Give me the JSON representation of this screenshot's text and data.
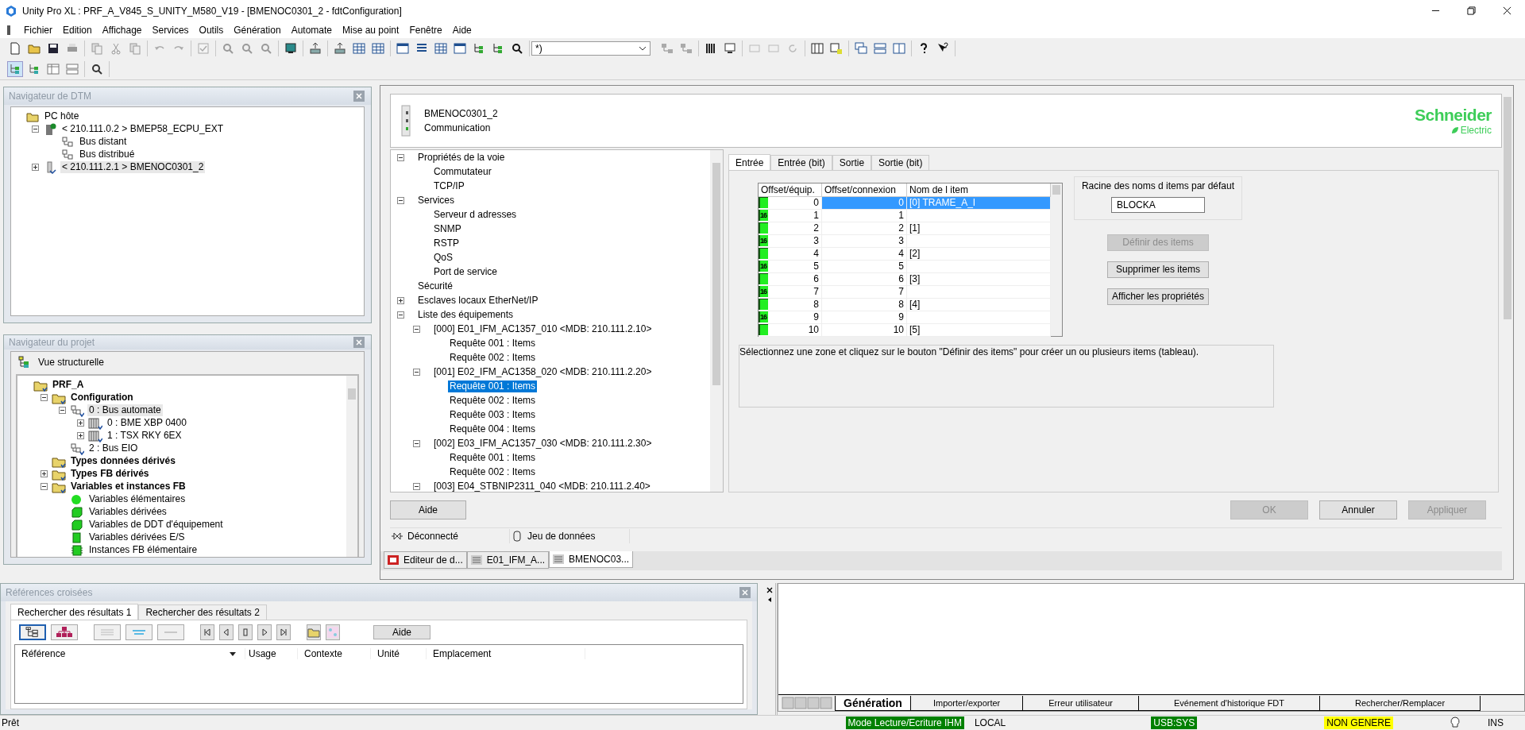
{
  "window": {
    "title": "Unity Pro XL : PRF_A_V845_S_UNITY_M580_V19 - [BMENOC0301_2 - fdtConfiguration]"
  },
  "menu": [
    "Fichier",
    "Edition",
    "Affichage",
    "Services",
    "Outils",
    "Génération",
    "Automate",
    "Mise au point",
    "Fenêtre",
    "Aide"
  ],
  "toolbar": {
    "combo_value": "*)"
  },
  "dtm_navigator": {
    "title": "Navigateur de DTM",
    "tree": [
      {
        "label": "PC hôte",
        "kind": "host",
        "selected": false,
        "children": [
          {
            "label": "< 210.111.0.2 > BMEP58_ECPU_EXT",
            "kind": "cpu",
            "selected": false,
            "expanded": true,
            "children": [
              {
                "label": "Bus distant",
                "kind": "bus",
                "selected": false
              },
              {
                "label": "Bus distribué",
                "kind": "bus",
                "selected": false
              }
            ]
          },
          {
            "label": "< 210.111.2.1 > BMENOC0301_2",
            "kind": "module",
            "selected": true,
            "expanded": false
          }
        ]
      }
    ]
  },
  "project_navigator": {
    "title": "Navigateur du projet",
    "view_label": "Vue structurelle",
    "tree": [
      {
        "label": "PRF_A",
        "kind": "folder",
        "selected": false,
        "children": [
          {
            "label": "Configuration",
            "kind": "folder",
            "selected": false,
            "expanded": true,
            "children": [
              {
                "label": "0 : Bus automate",
                "kind": "bus",
                "selected": true,
                "expanded": true,
                "children": [
                  {
                    "label": "0 : BME XBP 0400",
                    "kind": "rack",
                    "selected": false,
                    "expanded": false
                  },
                  {
                    "label": "1 : TSX RKY 6EX",
                    "kind": "rack",
                    "selected": false,
                    "expanded": false
                  }
                ]
              },
              {
                "label": "2 : Bus EIO",
                "kind": "bus",
                "selected": false
              }
            ]
          },
          {
            "label": "Types données dérivés",
            "kind": "folder",
            "selected": false
          },
          {
            "label": "Types FB dérivés",
            "kind": "folder",
            "selected": false,
            "expanded": false
          },
          {
            "label": "Variables et instances FB",
            "kind": "folder",
            "selected": false,
            "expanded": true,
            "children": [
              {
                "label": "Variables élémentaires",
                "kind": "dot",
                "selected": false
              },
              {
                "label": "Variables dérivées",
                "kind": "cube",
                "selected": false
              },
              {
                "label": "Variables de DDT d'équipement",
                "kind": "cube",
                "selected": false
              },
              {
                "label": "Variables dérivées E/S",
                "kind": "block",
                "selected": false
              },
              {
                "label": "Instances FB élémentaire",
                "kind": "chip",
                "selected": false
              }
            ]
          }
        ]
      }
    ]
  },
  "device": {
    "name": "BMENOC0301_2",
    "category": "Communication",
    "logo": [
      "Schneider",
      "Electric"
    ],
    "tree": [
      {
        "label": "Propriétés de la voie",
        "selected": false,
        "expanded": true,
        "children": [
          {
            "label": "Commutateur",
            "selected": false
          },
          {
            "label": "TCP/IP",
            "selected": false
          }
        ]
      },
      {
        "label": "Services",
        "selected": false,
        "expanded": true,
        "children": [
          {
            "label": "Serveur d adresses",
            "selected": false
          },
          {
            "label": "SNMP",
            "selected": false
          },
          {
            "label": "RSTP",
            "selected": false
          },
          {
            "label": "QoS",
            "selected": false
          },
          {
            "label": "Port de service",
            "selected": false
          }
        ]
      },
      {
        "label": "Sécurité",
        "selected": false
      },
      {
        "label": "Esclaves locaux EtherNet/IP",
        "selected": false,
        "expanded": false
      },
      {
        "label": "Liste des équipements",
        "selected": false,
        "expanded": true,
        "children": [
          {
            "label": "[000] E01_IFM_AC1357_010 <MDB: 210.111.2.10>",
            "selected": false,
            "expanded": true,
            "children": [
              {
                "label": "Requête 001 : Items",
                "selected": false
              },
              {
                "label": "Requête 002 : Items",
                "selected": false
              }
            ]
          },
          {
            "label": "[001] E02_IFM_AC1358_020 <MDB: 210.111.2.20>",
            "selected": false,
            "expanded": true,
            "children": [
              {
                "label": "Requête 001 : Items",
                "selected": true
              },
              {
                "label": "Requête 002 : Items",
                "selected": false
              },
              {
                "label": "Requête 003 : Items",
                "selected": false
              },
              {
                "label": "Requête 004 : Items",
                "selected": false
              }
            ]
          },
          {
            "label": "[002] E03_IFM_AC1357_030 <MDB: 210.111.2.30>",
            "selected": false,
            "expanded": true,
            "children": [
              {
                "label": "Requête 001 : Items",
                "selected": false
              },
              {
                "label": "Requête 002 : Items",
                "selected": false
              }
            ]
          },
          {
            "label": "[003] E04_STBNIP2311_040 <MDB: 210.111.2.40>",
            "selected": false,
            "expanded": true
          }
        ]
      }
    ],
    "tabs": [
      {
        "label": "Entrée",
        "selected": true
      },
      {
        "label": "Entrée (bit)",
        "selected": false
      },
      {
        "label": "Sortie",
        "selected": false
      },
      {
        "label": "Sortie (bit)",
        "selected": false
      }
    ],
    "table": {
      "columns": [
        "Offset/équip.",
        "Offset/connexion",
        "Nom de l item"
      ],
      "rows": [
        {
          "offset_device": "0",
          "offset_connection": "0",
          "item_name": "[0] TRAME_A_I",
          "selected": true
        },
        {
          "badge": "16",
          "offset_device": "1",
          "offset_connection": "1",
          "selected": false
        },
        {
          "offset_device": "2",
          "offset_connection": "2",
          "item_name": "[1]",
          "selected": false
        },
        {
          "badge": "16",
          "offset_device": "3",
          "offset_connection": "3",
          "selected": false
        },
        {
          "offset_device": "4",
          "offset_connection": "4",
          "item_name": "[2]",
          "selected": false
        },
        {
          "badge": "16",
          "offset_device": "5",
          "offset_connection": "5",
          "selected": false
        },
        {
          "offset_device": "6",
          "offset_connection": "6",
          "item_name": "[3]",
          "selected": false
        },
        {
          "badge": "16",
          "offset_device": "7",
          "offset_connection": "7",
          "selected": false
        },
        {
          "offset_device": "8",
          "offset_connection": "8",
          "item_name": "[4]",
          "selected": false
        },
        {
          "badge": "16",
          "offset_device": "9",
          "offset_connection": "9",
          "selected": false
        },
        {
          "offset_device": "10",
          "offset_connection": "10",
          "item_name": "[5]",
          "selected": false
        }
      ]
    },
    "root_names": {
      "label": "Racine des noms d items par défaut",
      "value": "BLOCKA"
    },
    "actions": [
      {
        "label": "Définir des items",
        "disabled": true
      },
      {
        "label": "Supprimer les items",
        "disabled": false
      },
      {
        "label": "Afficher les propriétés",
        "disabled": false
      }
    ],
    "hint": "Sélectionnez une zone et cliquez sur le bouton \"Définir des items\" pour créer un ou plusieurs items (tableau).",
    "help_button": "Aide",
    "buttons": [
      {
        "label": "OK",
        "disabled": true
      },
      {
        "label": "Annuler",
        "disabled": false
      },
      {
        "label": "Appliquer",
        "disabled": true
      }
    ],
    "status": [
      "Déconnecté",
      "Jeu de données"
    ]
  },
  "document_tabs": [
    {
      "label": "Editeur de d...",
      "kind": "editor",
      "selected": false
    },
    {
      "label": "E01_IFM_A...",
      "kind": "device",
      "selected": false
    },
    {
      "label": "BMENOC03...",
      "kind": "device",
      "selected": true
    }
  ],
  "cross_references": {
    "title": "Références croisées",
    "tabs": [
      {
        "label": "Rechercher des résultats 1",
        "selected": true
      },
      {
        "label": "Rechercher des résultats 2",
        "selected": false
      }
    ],
    "help_button": "Aide",
    "columns": [
      "Référence",
      "Usage",
      "Contexte",
      "Unité",
      "Emplacement"
    ]
  },
  "output": {
    "tabs": [
      {
        "label": "Génération",
        "selected": true
      },
      {
        "label": "Importer/exporter",
        "selected": false
      },
      {
        "label": "Erreur utilisateur",
        "selected": false
      },
      {
        "label": "Evénement d'historique FDT",
        "selected": false
      },
      {
        "label": "Rechercher/Remplacer",
        "selected": false
      }
    ]
  },
  "status_bar": {
    "ready": "Prêt",
    "fields": [
      {
        "text": "Mode Lecture/Ecriture IHM",
        "color": "#008000"
      },
      {
        "text": "LOCAL"
      },
      {
        "text": "USB:SYS",
        "color": "#008000"
      },
      {
        "text": "NON GENERE",
        "color": "#ffff00"
      },
      {
        "text": "INS",
        "kind": "with_bulb"
      }
    ]
  }
}
